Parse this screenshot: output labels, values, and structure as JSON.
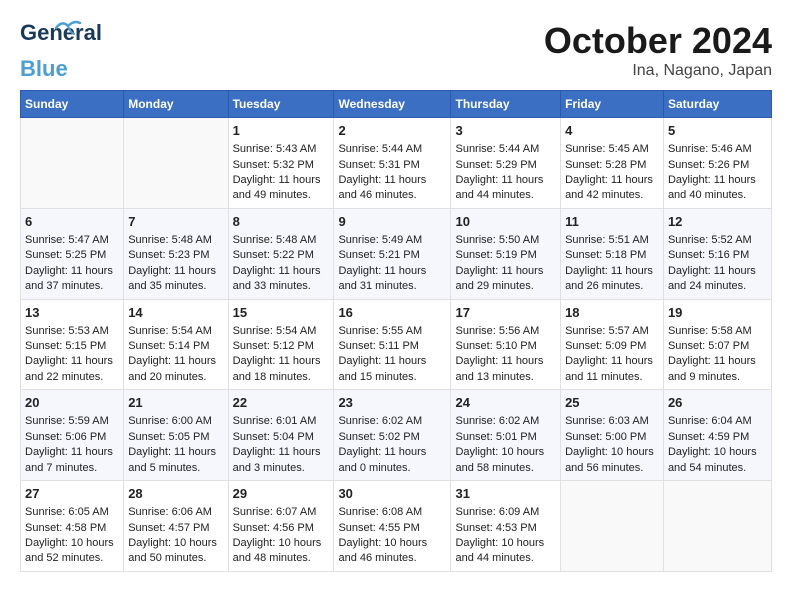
{
  "header": {
    "logo_general": "General",
    "logo_blue": "Blue",
    "month": "October 2024",
    "location": "Ina, Nagano, Japan"
  },
  "days_of_week": [
    "Sunday",
    "Monday",
    "Tuesday",
    "Wednesday",
    "Thursday",
    "Friday",
    "Saturday"
  ],
  "weeks": [
    [
      {
        "day": "",
        "sunrise": "",
        "sunset": "",
        "daylight": ""
      },
      {
        "day": "",
        "sunrise": "",
        "sunset": "",
        "daylight": ""
      },
      {
        "day": "1",
        "sunrise": "Sunrise: 5:43 AM",
        "sunset": "Sunset: 5:32 PM",
        "daylight": "Daylight: 11 hours and 49 minutes."
      },
      {
        "day": "2",
        "sunrise": "Sunrise: 5:44 AM",
        "sunset": "Sunset: 5:31 PM",
        "daylight": "Daylight: 11 hours and 46 minutes."
      },
      {
        "day": "3",
        "sunrise": "Sunrise: 5:44 AM",
        "sunset": "Sunset: 5:29 PM",
        "daylight": "Daylight: 11 hours and 44 minutes."
      },
      {
        "day": "4",
        "sunrise": "Sunrise: 5:45 AM",
        "sunset": "Sunset: 5:28 PM",
        "daylight": "Daylight: 11 hours and 42 minutes."
      },
      {
        "day": "5",
        "sunrise": "Sunrise: 5:46 AM",
        "sunset": "Sunset: 5:26 PM",
        "daylight": "Daylight: 11 hours and 40 minutes."
      }
    ],
    [
      {
        "day": "6",
        "sunrise": "Sunrise: 5:47 AM",
        "sunset": "Sunset: 5:25 PM",
        "daylight": "Daylight: 11 hours and 37 minutes."
      },
      {
        "day": "7",
        "sunrise": "Sunrise: 5:48 AM",
        "sunset": "Sunset: 5:23 PM",
        "daylight": "Daylight: 11 hours and 35 minutes."
      },
      {
        "day": "8",
        "sunrise": "Sunrise: 5:48 AM",
        "sunset": "Sunset: 5:22 PM",
        "daylight": "Daylight: 11 hours and 33 minutes."
      },
      {
        "day": "9",
        "sunrise": "Sunrise: 5:49 AM",
        "sunset": "Sunset: 5:21 PM",
        "daylight": "Daylight: 11 hours and 31 minutes."
      },
      {
        "day": "10",
        "sunrise": "Sunrise: 5:50 AM",
        "sunset": "Sunset: 5:19 PM",
        "daylight": "Daylight: 11 hours and 29 minutes."
      },
      {
        "day": "11",
        "sunrise": "Sunrise: 5:51 AM",
        "sunset": "Sunset: 5:18 PM",
        "daylight": "Daylight: 11 hours and 26 minutes."
      },
      {
        "day": "12",
        "sunrise": "Sunrise: 5:52 AM",
        "sunset": "Sunset: 5:16 PM",
        "daylight": "Daylight: 11 hours and 24 minutes."
      }
    ],
    [
      {
        "day": "13",
        "sunrise": "Sunrise: 5:53 AM",
        "sunset": "Sunset: 5:15 PM",
        "daylight": "Daylight: 11 hours and 22 minutes."
      },
      {
        "day": "14",
        "sunrise": "Sunrise: 5:54 AM",
        "sunset": "Sunset: 5:14 PM",
        "daylight": "Daylight: 11 hours and 20 minutes."
      },
      {
        "day": "15",
        "sunrise": "Sunrise: 5:54 AM",
        "sunset": "Sunset: 5:12 PM",
        "daylight": "Daylight: 11 hours and 18 minutes."
      },
      {
        "day": "16",
        "sunrise": "Sunrise: 5:55 AM",
        "sunset": "Sunset: 5:11 PM",
        "daylight": "Daylight: 11 hours and 15 minutes."
      },
      {
        "day": "17",
        "sunrise": "Sunrise: 5:56 AM",
        "sunset": "Sunset: 5:10 PM",
        "daylight": "Daylight: 11 hours and 13 minutes."
      },
      {
        "day": "18",
        "sunrise": "Sunrise: 5:57 AM",
        "sunset": "Sunset: 5:09 PM",
        "daylight": "Daylight: 11 hours and 11 minutes."
      },
      {
        "day": "19",
        "sunrise": "Sunrise: 5:58 AM",
        "sunset": "Sunset: 5:07 PM",
        "daylight": "Daylight: 11 hours and 9 minutes."
      }
    ],
    [
      {
        "day": "20",
        "sunrise": "Sunrise: 5:59 AM",
        "sunset": "Sunset: 5:06 PM",
        "daylight": "Daylight: 11 hours and 7 minutes."
      },
      {
        "day": "21",
        "sunrise": "Sunrise: 6:00 AM",
        "sunset": "Sunset: 5:05 PM",
        "daylight": "Daylight: 11 hours and 5 minutes."
      },
      {
        "day": "22",
        "sunrise": "Sunrise: 6:01 AM",
        "sunset": "Sunset: 5:04 PM",
        "daylight": "Daylight: 11 hours and 3 minutes."
      },
      {
        "day": "23",
        "sunrise": "Sunrise: 6:02 AM",
        "sunset": "Sunset: 5:02 PM",
        "daylight": "Daylight: 11 hours and 0 minutes."
      },
      {
        "day": "24",
        "sunrise": "Sunrise: 6:02 AM",
        "sunset": "Sunset: 5:01 PM",
        "daylight": "Daylight: 10 hours and 58 minutes."
      },
      {
        "day": "25",
        "sunrise": "Sunrise: 6:03 AM",
        "sunset": "Sunset: 5:00 PM",
        "daylight": "Daylight: 10 hours and 56 minutes."
      },
      {
        "day": "26",
        "sunrise": "Sunrise: 6:04 AM",
        "sunset": "Sunset: 4:59 PM",
        "daylight": "Daylight: 10 hours and 54 minutes."
      }
    ],
    [
      {
        "day": "27",
        "sunrise": "Sunrise: 6:05 AM",
        "sunset": "Sunset: 4:58 PM",
        "daylight": "Daylight: 10 hours and 52 minutes."
      },
      {
        "day": "28",
        "sunrise": "Sunrise: 6:06 AM",
        "sunset": "Sunset: 4:57 PM",
        "daylight": "Daylight: 10 hours and 50 minutes."
      },
      {
        "day": "29",
        "sunrise": "Sunrise: 6:07 AM",
        "sunset": "Sunset: 4:56 PM",
        "daylight": "Daylight: 10 hours and 48 minutes."
      },
      {
        "day": "30",
        "sunrise": "Sunrise: 6:08 AM",
        "sunset": "Sunset: 4:55 PM",
        "daylight": "Daylight: 10 hours and 46 minutes."
      },
      {
        "day": "31",
        "sunrise": "Sunrise: 6:09 AM",
        "sunset": "Sunset: 4:53 PM",
        "daylight": "Daylight: 10 hours and 44 minutes."
      },
      {
        "day": "",
        "sunrise": "",
        "sunset": "",
        "daylight": ""
      },
      {
        "day": "",
        "sunrise": "",
        "sunset": "",
        "daylight": ""
      }
    ]
  ]
}
